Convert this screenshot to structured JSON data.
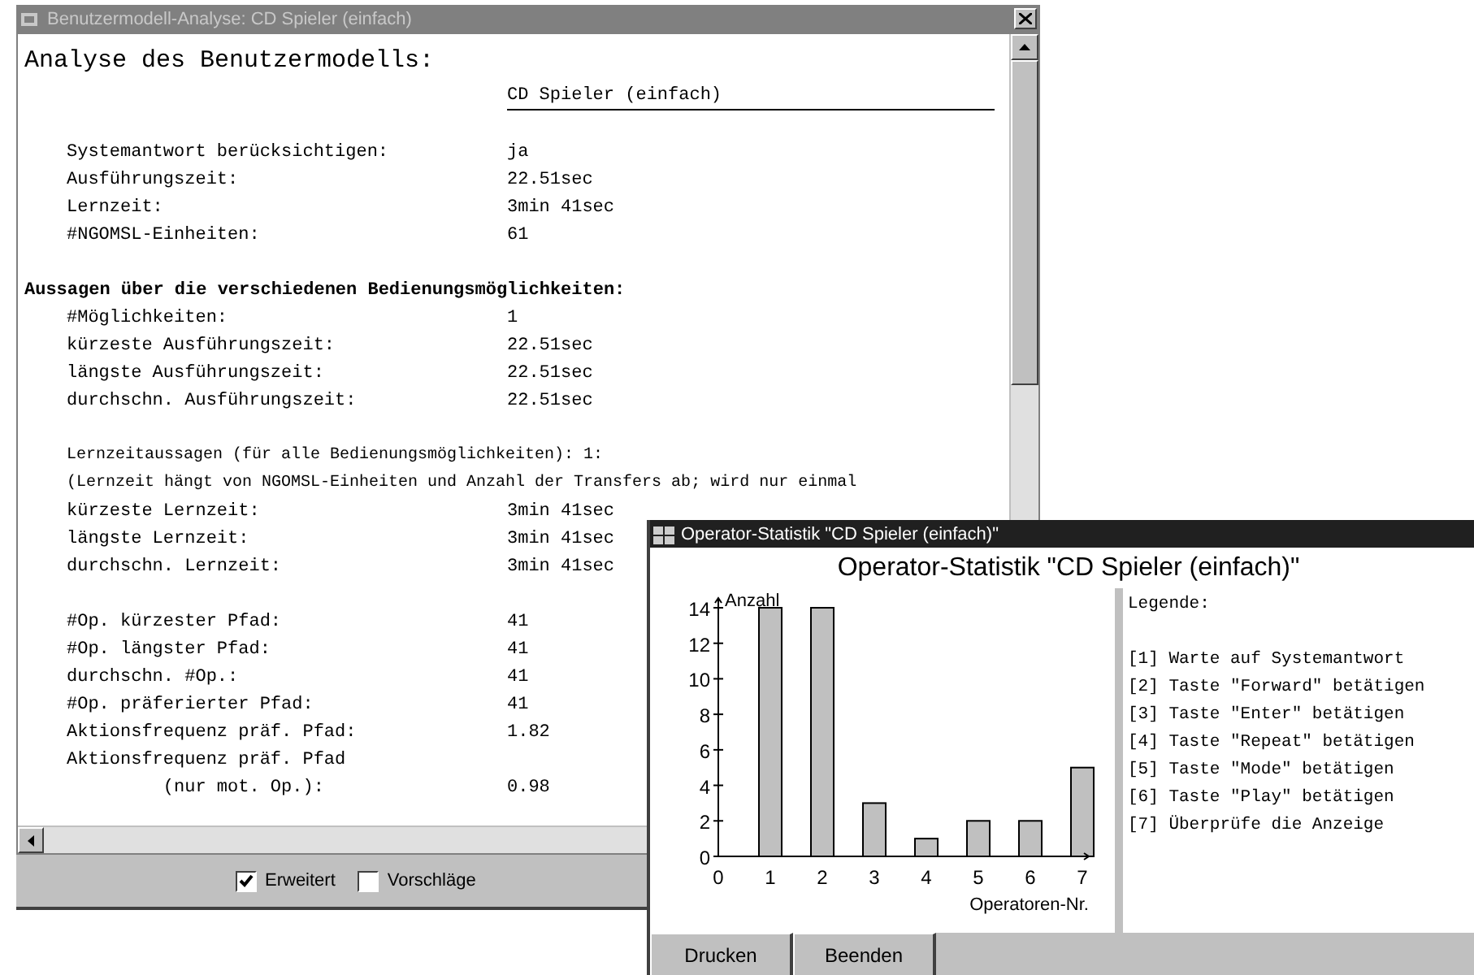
{
  "main_window": {
    "title": "Benutzermodell-Analyse: CD Spieler (einfach)",
    "heading": "Analyse des Benutzermodells:",
    "subtitle": "CD Spieler (einfach)",
    "rows": [
      {
        "kind": "blank"
      },
      {
        "kind": "row",
        "label": "Systemantwort berücksichtigen:",
        "value": "ja"
      },
      {
        "kind": "row",
        "label": "Ausführungszeit:",
        "value": "22.51sec"
      },
      {
        "kind": "row",
        "label": "Lernzeit:",
        "value": "3min 41sec"
      },
      {
        "kind": "row",
        "label": "#NGOMSL-Einheiten:",
        "value": "61"
      },
      {
        "kind": "blank"
      },
      {
        "kind": "section",
        "label": "Aussagen über die verschiedenen Bedienungsmöglichkeiten:"
      },
      {
        "kind": "row",
        "label": "#Möglichkeiten:",
        "value": "1"
      },
      {
        "kind": "row",
        "label": "kürzeste Ausführungszeit:",
        "value": "22.51sec"
      },
      {
        "kind": "row",
        "label": "längste Ausführungszeit:",
        "value": "22.51sec"
      },
      {
        "kind": "row",
        "label": "durchschn. Ausführungszeit:",
        "value": "22.51sec"
      },
      {
        "kind": "blank"
      },
      {
        "kind": "note",
        "label": "Lernzeitaussagen (für alle Bedienungsmöglichkeiten): 1:"
      },
      {
        "kind": "note",
        "label": "(Lernzeit hängt von NGOMSL-Einheiten und Anzahl der Transfers ab; wird nur einmal"
      },
      {
        "kind": "row",
        "label": "kürzeste Lernzeit:",
        "value": "3min 41sec"
      },
      {
        "kind": "row",
        "label": "längste Lernzeit:",
        "value": "3min 41sec"
      },
      {
        "kind": "row",
        "label": "durchschn. Lernzeit:",
        "value": "3min 41sec"
      },
      {
        "kind": "blank"
      },
      {
        "kind": "row",
        "label": "#Op. kürzester Pfad:",
        "value": "41"
      },
      {
        "kind": "row",
        "label": "#Op. längster Pfad:",
        "value": "41"
      },
      {
        "kind": "row",
        "label": "durchschn. #Op.:",
        "value": "41"
      },
      {
        "kind": "row",
        "label": "#Op. präferierter Pfad:",
        "value": "41"
      },
      {
        "kind": "row",
        "label": "Aktionsfrequenz präf. Pfad:",
        "value": "1.82"
      },
      {
        "kind": "row",
        "label": "Aktionsfrequenz präf. Pfad",
        "value": ""
      },
      {
        "kind": "row",
        "label": "         (nur mot. Op.):",
        "value": "0.98"
      }
    ],
    "checkboxes": [
      {
        "label": "Erweitert",
        "checked": true
      },
      {
        "label": "Vorschläge",
        "checked": false
      }
    ]
  },
  "chart_window": {
    "title": "Operator-Statistik \"CD Spieler (einfach)\"",
    "heading": "Operator-Statistik \"CD Spieler (einfach)\"",
    "chart_data": {
      "type": "bar",
      "xlabel": "Operatoren-Nr.",
      "ylabel": "Anzahl",
      "categories": [
        "1",
        "2",
        "3",
        "4",
        "5",
        "6",
        "7"
      ],
      "values": [
        14,
        14,
        3,
        1,
        2,
        2,
        5
      ],
      "ylim": [
        0,
        14
      ],
      "yticks": [
        0,
        2,
        4,
        6,
        8,
        10,
        12,
        14
      ]
    },
    "x_origin_label": "0",
    "legend_title": "Legende:",
    "legend": [
      "[1] Warte auf Systemantwort",
      "[2] Taste \"Forward\" betätigen",
      "[3] Taste \"Enter\" betätigen",
      "[4] Taste \"Repeat\" betätigen",
      "[5] Taste \"Mode\" betätigen",
      "[6] Taste \"Play\" betätigen",
      "[7] Überprüfe die Anzeige"
    ],
    "buttons": [
      "Drucken",
      "Beenden"
    ]
  }
}
